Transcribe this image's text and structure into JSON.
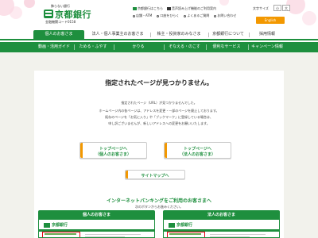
{
  "header": {
    "tagline": "飾らない銀行",
    "bank_name": "京都銀行",
    "bank_code": "金融機関コード0158",
    "links_row1": [
      "京都銀行はこちら",
      "音声読み上げ機能のご利用案内"
    ],
    "links_row2": [
      "店舗・ATM",
      "口座をひらく",
      "よくあるご質問",
      "お問い合わせ"
    ],
    "text_size_label": "文字サイズ",
    "size_labels": [
      "小",
      "大"
    ],
    "english_label": "English"
  },
  "nav_primary": {
    "items": [
      "個人のお客さま",
      "法人・個人事業主のお客さま",
      "株主・投資家のみなさま",
      "京都銀行について",
      "採用情報"
    ],
    "active_index": 0
  },
  "nav_secondary": {
    "items": [
      "動画・活用ガイド",
      "ためる・ふやす",
      "かりる",
      "そなえる・のこす",
      "便利なサービス",
      "キャンペーン情報"
    ]
  },
  "error": {
    "title": "指定されたページが見つかりません。",
    "lines": [
      "指定されたページ（URL）が見つかりませんでした。",
      "ホームページ内の各ページは、アドレスを変更・一部のページを廃止しております。",
      "既存のページを「お気に入り」や「ブックマーク」に登録している場合は、",
      "申し訳ございませんが、新しいアドレスへの変更をお願いいたします。"
    ]
  },
  "buttons": {
    "top_personal": {
      "line1": "トップページへ",
      "line2": "（個人のお客さま）"
    },
    "top_corporate": {
      "line1": "トップページへ",
      "line2": "（法人のお客さま）"
    },
    "sitemap": "サイトマップへ"
  },
  "internet_banking": {
    "title": "インターネットバンキングをご利用のお客さまへ",
    "subtitle": "次のボタンからお進みください。",
    "cards": [
      "個人のお客さま",
      "法人のお客さま"
    ],
    "preview_logo_text": "京都銀行"
  },
  "colors": {
    "brand_green": "#1e8f3e",
    "accent_orange": "#f39800",
    "highlight_red": "#e60012"
  }
}
